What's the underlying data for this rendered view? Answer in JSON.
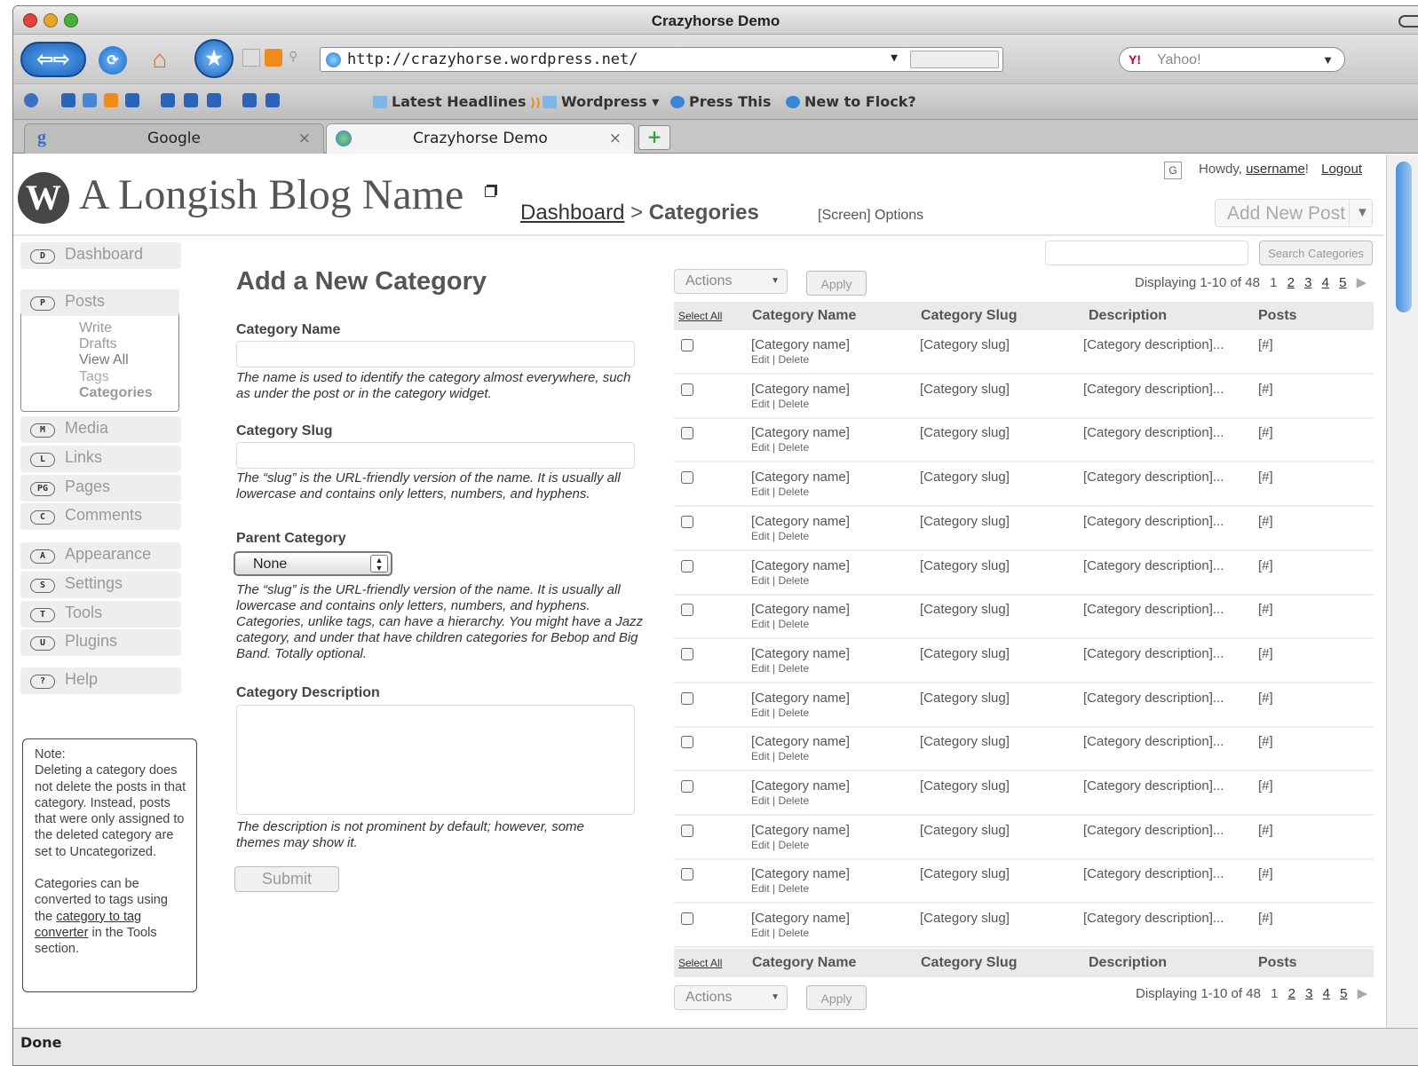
{
  "window": {
    "title": "Crazyhorse Demo"
  },
  "toolbar": {
    "url": "http://crazyhorse.wordpress.net/",
    "search_placeholder": "Yahoo!"
  },
  "bookmarks": [
    {
      "label": "Latest Headlines"
    },
    {
      "label": "Wordpress ▾"
    },
    {
      "label": "Press This"
    },
    {
      "label": "New to Flock?"
    }
  ],
  "tabs": [
    {
      "label": "Google",
      "close": "×"
    },
    {
      "label": "Crazyhorse Demo",
      "close": "×"
    }
  ],
  "header": {
    "blog_name": "A Longish Blog Name",
    "breadcrumb_dashboard": "Dashboard",
    "breadcrumb_sep": ">",
    "breadcrumb_current": "Categories",
    "screen_options": "[Screen] Options",
    "g_badge": "G",
    "howdy": "Howdy,",
    "username": "username",
    "howdy_end": "!",
    "logout": "Logout",
    "add_new_post": "Add New Post",
    "search_button": "Search Categories"
  },
  "sidebar": {
    "dashboard": {
      "key": "D",
      "label": "Dashboard"
    },
    "posts": {
      "key": "P",
      "label": "Posts",
      "subitems": [
        "Write",
        "Drafts",
        "View All",
        "Tags",
        "Categories"
      ]
    },
    "media": {
      "key": "M",
      "label": "Media"
    },
    "links": {
      "key": "L",
      "label": "Links"
    },
    "pages": {
      "key": "PG",
      "label": "Pages"
    },
    "comments": {
      "key": "C",
      "label": "Comments"
    },
    "appearance": {
      "key": "A",
      "label": "Appearance"
    },
    "settings": {
      "key": "S",
      "label": "Settings"
    },
    "tools": {
      "key": "T",
      "label": "Tools"
    },
    "plugins": {
      "key": "U",
      "label": "Plugins"
    },
    "help": {
      "key": "?",
      "label": "Help"
    }
  },
  "note": {
    "title": "Note:",
    "p1": "Deleting a category does not delete the posts in that category. Instead, posts that were only assigned to the deleted category are set to Uncategorized.",
    "p2_a": "Categories can be converted to tags using the",
    "p2_link": "category to tag converter",
    "p2_b": "in the Tools section."
  },
  "form": {
    "heading": "Add a New Category",
    "name_label": "Category Name",
    "name_help": "The name is used to identify the category almost everywhere, such as under the post or in the category widget.",
    "slug_label": "Category Slug",
    "slug_help": "The “slug” is the URL-friendly version of the name. It is usually all lowercase and contains only letters, numbers, and hyphens.",
    "parent_label": "Parent Category",
    "parent_value": "None",
    "parent_help": "The “slug” is the URL-friendly version of the name. It is usually all lowercase and contains only letters, numbers, and hyphens. Categories, unlike tags, can have a hierarchy. You might have a Jazz category, and under that have children categories for Bebop and Big Band. Totally optional.",
    "desc_label": "Category Description",
    "desc_help": "The description is not prominent by default; however, some themes may show it.",
    "submit": "Submit"
  },
  "table": {
    "actions": "Actions",
    "apply": "Apply",
    "displaying": "Displaying 1-10 of 48",
    "pages": [
      "1",
      "2",
      "3",
      "4",
      "5"
    ],
    "next": "▶",
    "select_all": "Select All",
    "col_name": "Category Name",
    "col_slug": "Category Slug",
    "col_desc": "Description",
    "col_posts": "Posts",
    "row": {
      "name": "[Category name]",
      "actions": "Edit | Delete",
      "slug": "[Category slug]",
      "desc": "[Category description]...",
      "posts": "[#]"
    },
    "row_count": 14
  },
  "status_bar": {
    "text": "Done"
  }
}
